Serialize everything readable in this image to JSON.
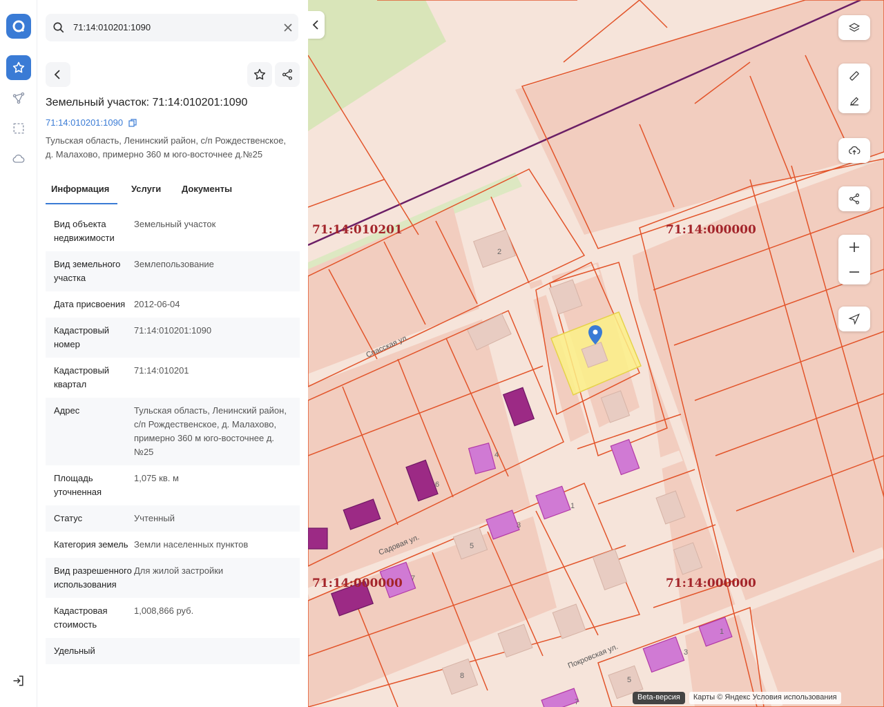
{
  "search": {
    "query": "71:14:010201:1090"
  },
  "object": {
    "title": "Земельный участок: 71:14:010201:1090",
    "cadastral_link": "71:14:010201:1090",
    "address": "Тульская область, Ленинский район, с/п Рождественское, д. Малахово, примерно 360 м юго-восточнее д.№25"
  },
  "tabs": {
    "info": "Информация",
    "services": "Услуги",
    "documents": "Документы"
  },
  "properties": [
    {
      "key": "Вид объекта недвижимости",
      "value": "Земельный участок"
    },
    {
      "key": "Вид земельного участка",
      "value": "Землепользование"
    },
    {
      "key": "Дата присвоения",
      "value": "2012-06-04"
    },
    {
      "key": "Кадастровый номер",
      "value": "71:14:010201:1090"
    },
    {
      "key": "Кадастровый квартал",
      "value": "71:14:010201"
    },
    {
      "key": "Адрес",
      "value": "Тульская область, Ленинский район, с/п Рождественское, д. Малахово, примерно 360 м юго-восточнее д.№25"
    },
    {
      "key": "Площадь уточненная",
      "value": "1,075 кв. м"
    },
    {
      "key": "Статус",
      "value": "Учтенный"
    },
    {
      "key": "Категория земель",
      "value": "Земли населенных пунктов"
    },
    {
      "key": "Вид разрешенного использования",
      "value": "Для жилой застройки"
    },
    {
      "key": "Кадастровая стоимость",
      "value": "1,008,866 руб."
    },
    {
      "key": "Удельный",
      "value": ""
    }
  ],
  "map": {
    "quarters": {
      "q1": "71:14:010201",
      "q2": "71:14:000000",
      "q3": "71:14:000000",
      "q4": "71:14:000000"
    },
    "streets": {
      "spasskaya": "Спасская ул.",
      "sadovaya": "Садовая ул.",
      "pokrovskaya": "Покровская ул."
    },
    "house_numbers": {
      "h2": "2",
      "h4": "4",
      "h6": "6",
      "h1a": "1",
      "h3a": "3",
      "h5": "5",
      "h7": "7",
      "h8": "8",
      "h3b": "3",
      "h1b": "1",
      "h5b": "5",
      "h7b": "7"
    },
    "footer": {
      "beta": "Beta-версия",
      "attribution": "Карты © Яндекс   Условия использования"
    }
  },
  "colors": {
    "accent": "#3a7bd5",
    "parcel_line": "#e2542a",
    "selected_parcel": "#fbf087",
    "quarter_label": "#a3242a",
    "map_bg": "#f6e4da",
    "boundary": "#6b1f66"
  }
}
